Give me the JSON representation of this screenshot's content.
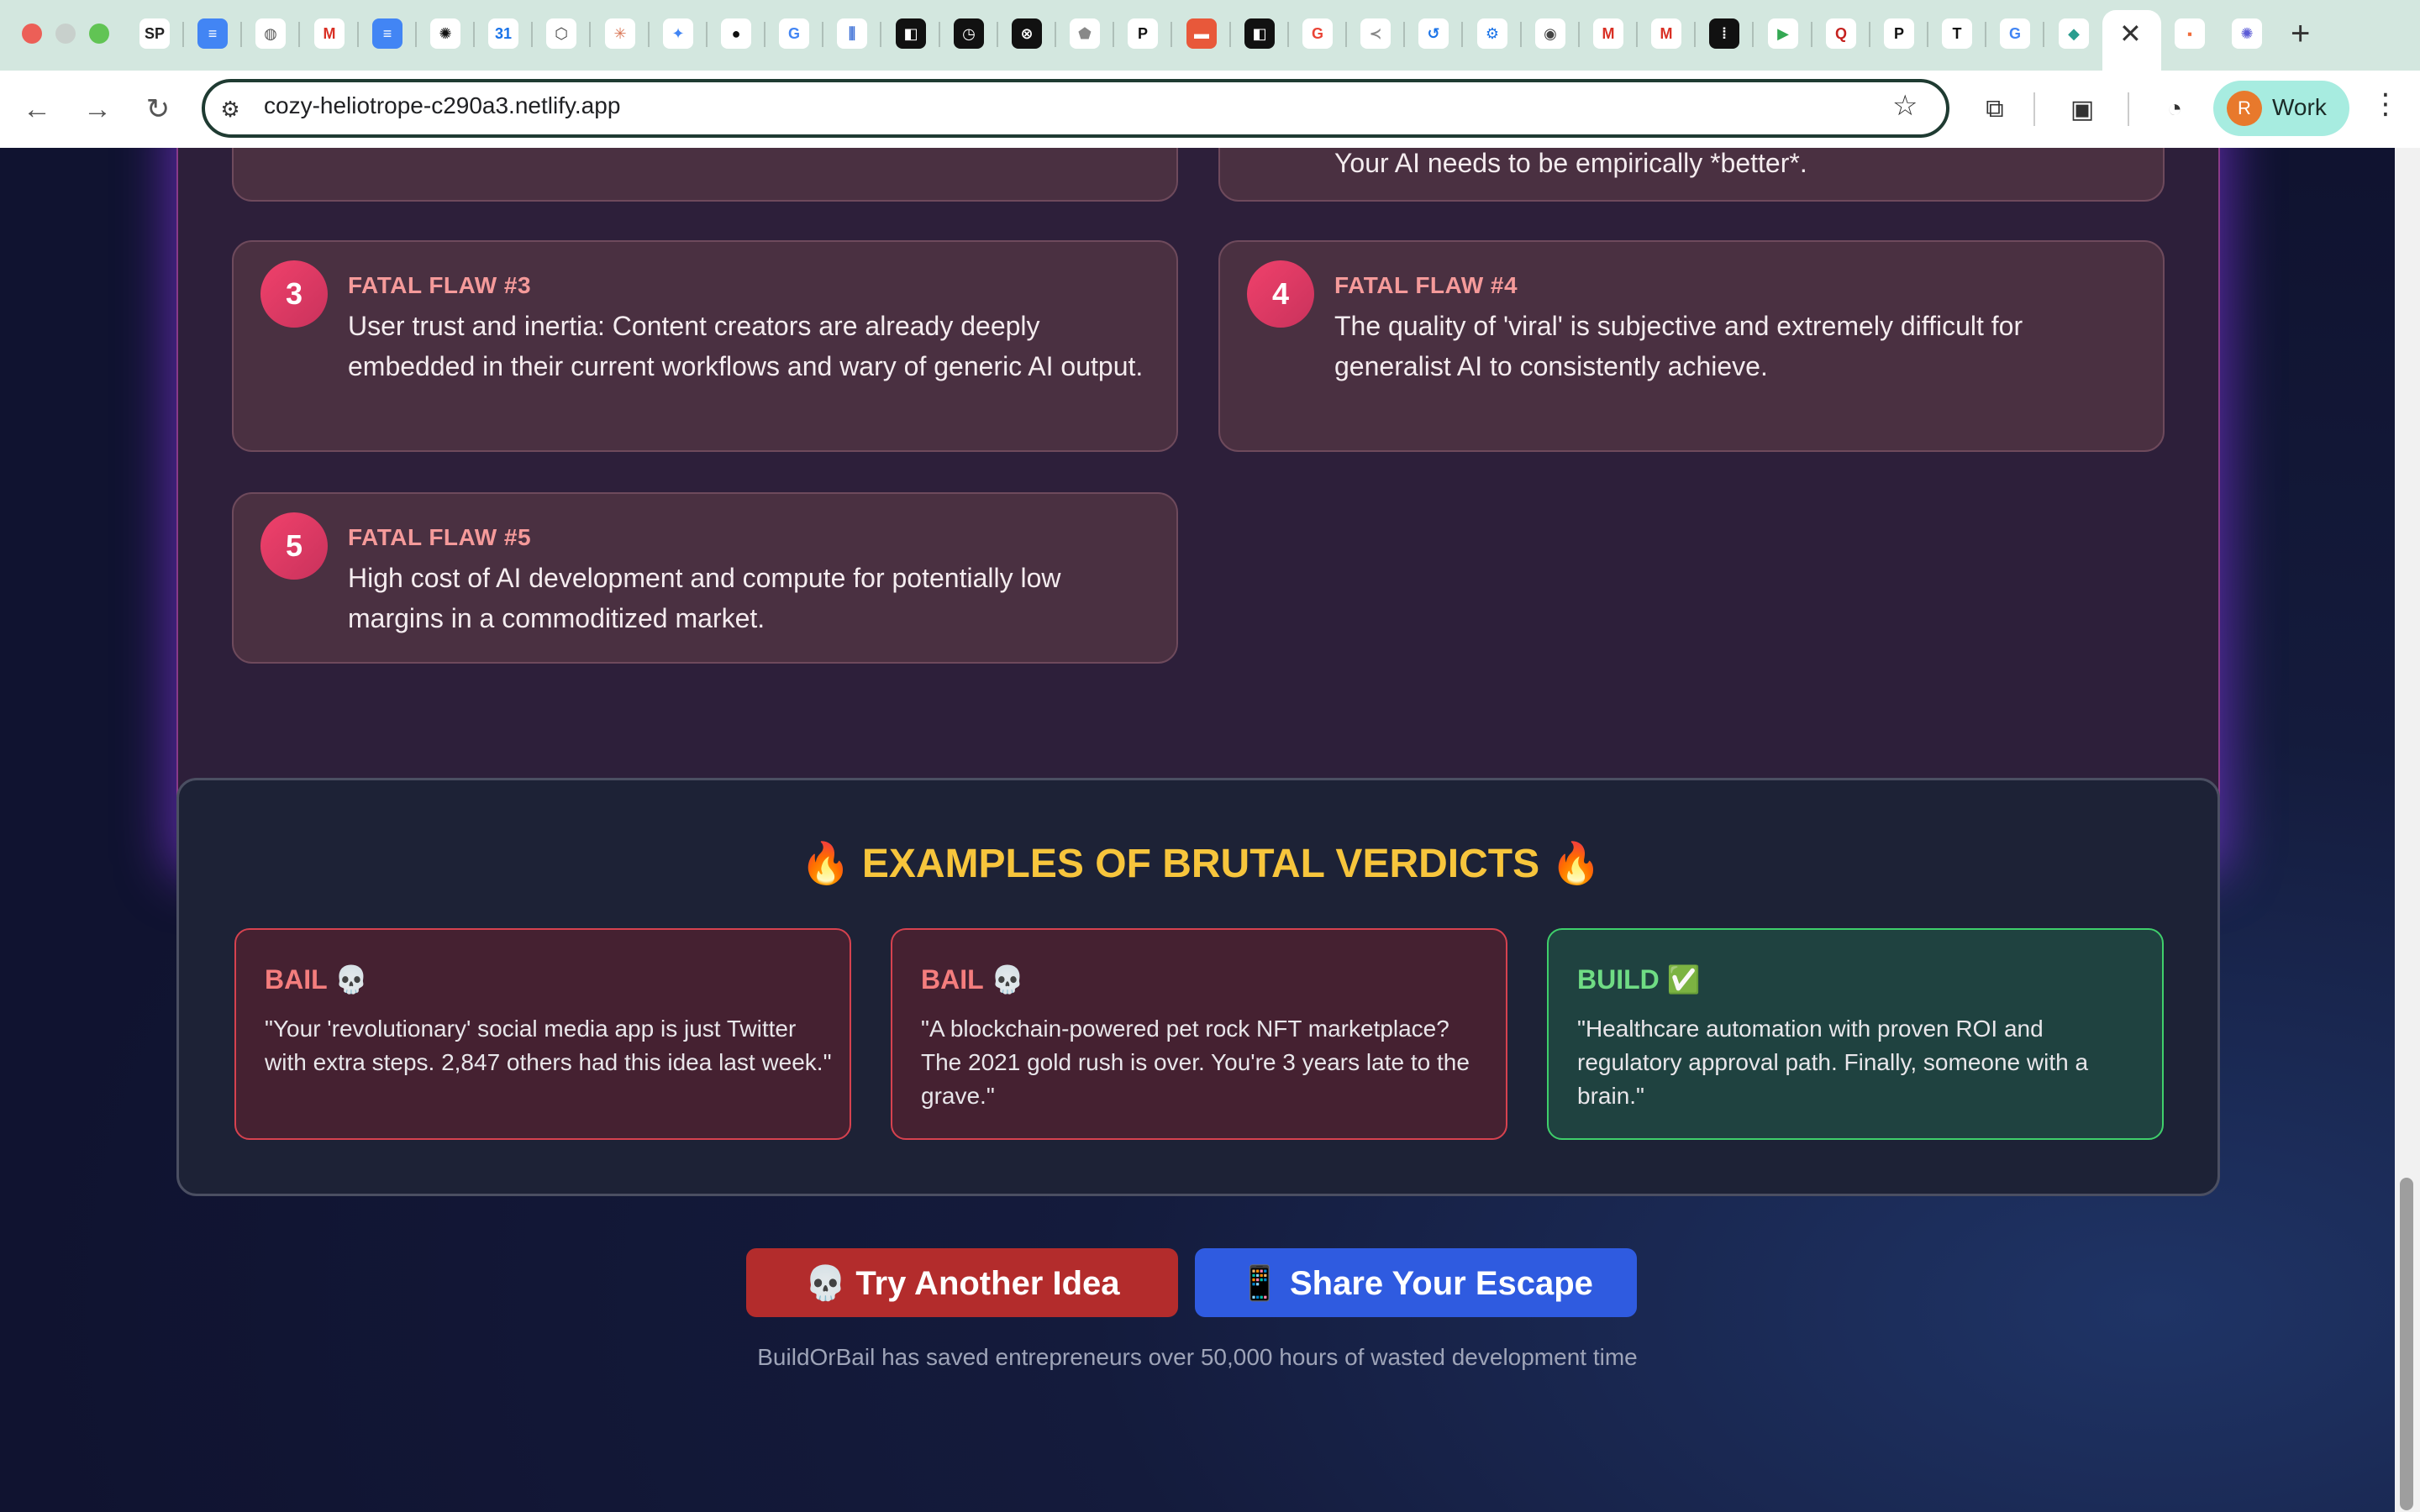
{
  "browser": {
    "url": "cozy-heliotrope-c290a3.netlify.app",
    "profile_initial": "R",
    "profile_name": "Work",
    "tab_icons": [
      {
        "name": "sp-icon",
        "glyph": "SP",
        "bg": "#ffffff",
        "fg": "#222222"
      },
      {
        "name": "docs-icon",
        "glyph": "≡",
        "bg": "#4285f4",
        "fg": "#ffffff"
      },
      {
        "name": "globe-icon",
        "glyph": "◍",
        "bg": "#ffffff",
        "fg": "#555555"
      },
      {
        "name": "gmail-icon",
        "glyph": "M",
        "bg": "#ffffff",
        "fg": "#d93025"
      },
      {
        "name": "docs-icon",
        "glyph": "≡",
        "bg": "#4285f4",
        "fg": "#ffffff"
      },
      {
        "name": "openai-icon",
        "glyph": "✺",
        "bg": "#ffffff",
        "fg": "#111111"
      },
      {
        "name": "calendar-icon",
        "glyph": "31",
        "bg": "#ffffff",
        "fg": "#1a73e8"
      },
      {
        "name": "box-icon",
        "glyph": "⬡",
        "bg": "#ffffff",
        "fg": "#444444"
      },
      {
        "name": "claude-icon",
        "glyph": "✳",
        "bg": "#ffffff",
        "fg": "#d97757"
      },
      {
        "name": "gemini-icon",
        "glyph": "✦",
        "bg": "#ffffff",
        "fg": "#4285f4"
      },
      {
        "name": "github-icon",
        "glyph": "●",
        "bg": "#ffffff",
        "fg": "#111111"
      },
      {
        "name": "google-icon",
        "glyph": "G",
        "bg": "#ffffff",
        "fg": "#4285f4"
      },
      {
        "name": "chart-icon",
        "glyph": "⫼",
        "bg": "#ffffff",
        "fg": "#3b6fd6"
      },
      {
        "name": "square-icon",
        "glyph": "◧",
        "bg": "#111111",
        "fg": "#ffffff"
      },
      {
        "name": "clock-icon",
        "glyph": "◷",
        "bg": "#111111",
        "fg": "#ffffff"
      },
      {
        "name": "pattern-icon",
        "glyph": "⊗",
        "bg": "#111111",
        "fg": "#ffffff"
      },
      {
        "name": "pentagon-icon",
        "glyph": "⬟",
        "bg": "#ffffff",
        "fg": "#888888"
      },
      {
        "name": "p-icon",
        "glyph": "P",
        "bg": "#ffffff",
        "fg": "#111111"
      },
      {
        "name": "orange-square-icon",
        "glyph": "▬",
        "bg": "#e8583a",
        "fg": "#ffffff"
      },
      {
        "name": "square-icon",
        "glyph": "◧",
        "bg": "#111111",
        "fg": "#ffffff"
      },
      {
        "name": "google-icon",
        "glyph": "G",
        "bg": "#ffffff",
        "fg": "#ea4335"
      },
      {
        "name": "arrow-icon",
        "glyph": "≺",
        "bg": "#ffffff",
        "fg": "#888888"
      },
      {
        "name": "history-icon",
        "glyph": "↺",
        "bg": "#ffffff",
        "fg": "#1a73e8"
      },
      {
        "name": "settings-icon",
        "glyph": "⚙",
        "bg": "#ffffff",
        "fg": "#1a73e8"
      },
      {
        "name": "chrome-icon",
        "glyph": "◉",
        "bg": "#ffffff",
        "fg": "#444444"
      },
      {
        "name": "gmail-icon",
        "glyph": "M",
        "bg": "#ffffff",
        "fg": "#d93025"
      },
      {
        "name": "gmail-icon",
        "glyph": "M",
        "bg": "#ffffff",
        "fg": "#d93025"
      },
      {
        "name": "bracket-icon",
        "glyph": "⁞",
        "bg": "#111111",
        "fg": "#ffffff"
      },
      {
        "name": "play-icon",
        "glyph": "▶",
        "bg": "#ffffff",
        "fg": "#34a853"
      },
      {
        "name": "q-icon",
        "glyph": "Q",
        "bg": "#ffffff",
        "fg": "#c5221f"
      },
      {
        "name": "p-icon",
        "glyph": "P",
        "bg": "#ffffff",
        "fg": "#111111"
      },
      {
        "name": "nyt-icon",
        "glyph": "T",
        "bg": "#ffffff",
        "fg": "#111111"
      },
      {
        "name": "google-icon",
        "glyph": "G",
        "bg": "#ffffff",
        "fg": "#4285f4"
      },
      {
        "name": "diamond-icon",
        "glyph": "◆",
        "bg": "#ffffff",
        "fg": "#2a9d8f"
      }
    ],
    "extra_tab_icons": [
      {
        "name": "orange-app-icon",
        "glyph": "⬝",
        "bg": "#ffffff",
        "fg": "#f06c3b"
      },
      {
        "name": "snowflake-icon",
        "glyph": "✺",
        "bg": "#ffffff",
        "fg": "#5b5bd6"
      }
    ]
  },
  "flaws": [
    {
      "number": "",
      "title": "",
      "text": "Your AI needs to be empirically *better*."
    },
    {
      "number": "3",
      "title": "FATAL FLAW #3",
      "text": "User trust and inertia: Content creators are already deeply embedded in their current workflows and wary of generic AI output."
    },
    {
      "number": "4",
      "title": "FATAL FLAW #4",
      "text": "The quality of 'viral' is subjective and extremely difficult for generalist AI to consistently achieve."
    },
    {
      "number": "5",
      "title": "FATAL FLAW #5",
      "text": "High cost of AI development and compute for potentially low margins in a commoditized market."
    }
  ],
  "examples": {
    "title": "🔥 EXAMPLES OF BRUTAL VERDICTS 🔥",
    "verdicts": [
      {
        "label": "BAIL 💀",
        "text": "\"Your 'revolutionary' social media app is just Twitter with extra steps. 2,847 others had this idea last week.\""
      },
      {
        "label": "BAIL 💀",
        "text": "\"A blockchain-powered pet rock NFT marketplace? The 2021 gold rush is over. You're 3 years late to the grave.\""
      },
      {
        "label": "BUILD ✅",
        "text": "\"Healthcare automation with proven ROI and regulatory approval path. Finally, someone with a brain.\""
      }
    ]
  },
  "actions": {
    "try_again": "💀 Try Another Idea",
    "share": "📱 Share Your Escape"
  },
  "footer": "BuildOrBail has saved entrepreneurs over 50,000 hours of wasted development time"
}
